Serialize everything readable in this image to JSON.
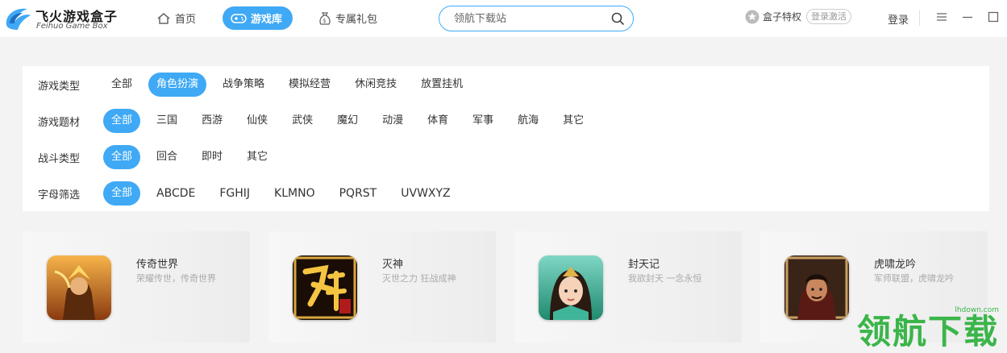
{
  "app": {
    "title": "飞火游戏盒子",
    "subtitle": "Feihuo Game Box"
  },
  "nav": {
    "home": "首页",
    "games": "游戏库",
    "gifts": "专属礼包"
  },
  "search": {
    "placeholder": "领航下载站"
  },
  "header": {
    "privilege": "盒子特权",
    "activate": "登录激活",
    "login": "登录"
  },
  "filters": [
    {
      "label": "游戏类型",
      "options": [
        "全部",
        "角色扮演",
        "战争策略",
        "模拟经营",
        "休闲竞技",
        "放置挂机"
      ],
      "active": 1
    },
    {
      "label": "游戏题材",
      "options": [
        "全部",
        "三国",
        "西游",
        "仙侠",
        "武侠",
        "魔幻",
        "动漫",
        "体育",
        "军事",
        "航海",
        "其它"
      ],
      "active": 0
    },
    {
      "label": "战斗类型",
      "options": [
        "全部",
        "回合",
        "即时",
        "其它"
      ],
      "active": 0
    },
    {
      "label": "字母筛选",
      "options": [
        "全部",
        "ABCDE",
        "FGHIJ",
        "KLMNO",
        "PQRST",
        "UVWXYZ"
      ],
      "active": 0
    }
  ],
  "games": [
    {
      "name": "传奇世界",
      "desc": "荣耀传世，传奇世界"
    },
    {
      "name": "灭神",
      "desc": "灭世之力 狂战成神"
    },
    {
      "name": "封天记",
      "desc": "我欲封天 一念永恒"
    },
    {
      "name": "虎啸龙吟",
      "desc": "军师联盟，虎啸龙吟"
    }
  ],
  "watermark": {
    "url": "lhdown.com",
    "text": "领航下载"
  },
  "colors": {
    "accent": "#3fa9f5",
    "watermark": "#3bb54a"
  }
}
